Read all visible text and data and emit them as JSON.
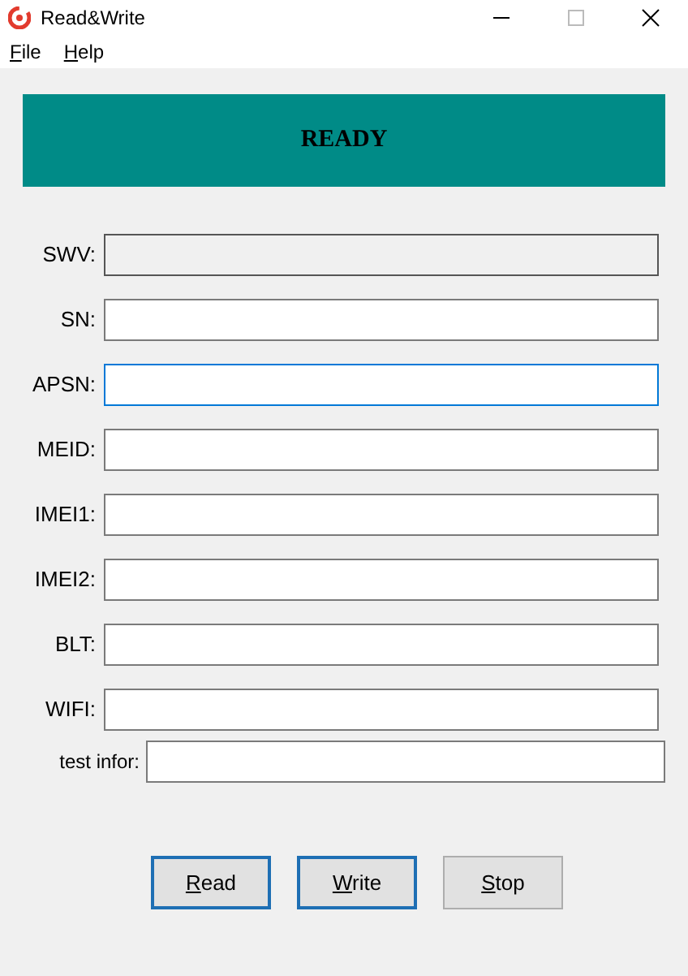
{
  "window": {
    "title": "Read&Write"
  },
  "menu": [
    {
      "label": "File"
    },
    {
      "label": "Help"
    }
  ],
  "status": {
    "text": "READY"
  },
  "fields": [
    {
      "label": "SWV:",
      "disabled": true,
      "focused": false
    },
    {
      "label": "SN:",
      "disabled": false,
      "focused": false
    },
    {
      "label": "APSN:",
      "disabled": false,
      "focused": true
    },
    {
      "label": "MEID:",
      "disabled": false,
      "focused": false
    },
    {
      "label": "IMEI1:",
      "disabled": false,
      "focused": false
    },
    {
      "label": "IMEI2:",
      "disabled": false,
      "focused": false
    },
    {
      "label": "BLT:",
      "disabled": false,
      "focused": false
    },
    {
      "label": "WIFI:",
      "disabled": false,
      "focused": false
    }
  ],
  "test_info": {
    "label": "test infor:"
  },
  "buttons": [
    {
      "label": "Read",
      "highlighted": true
    },
    {
      "label": "Write",
      "highlighted": true
    },
    {
      "label": "Stop",
      "highlighted": false
    }
  ]
}
